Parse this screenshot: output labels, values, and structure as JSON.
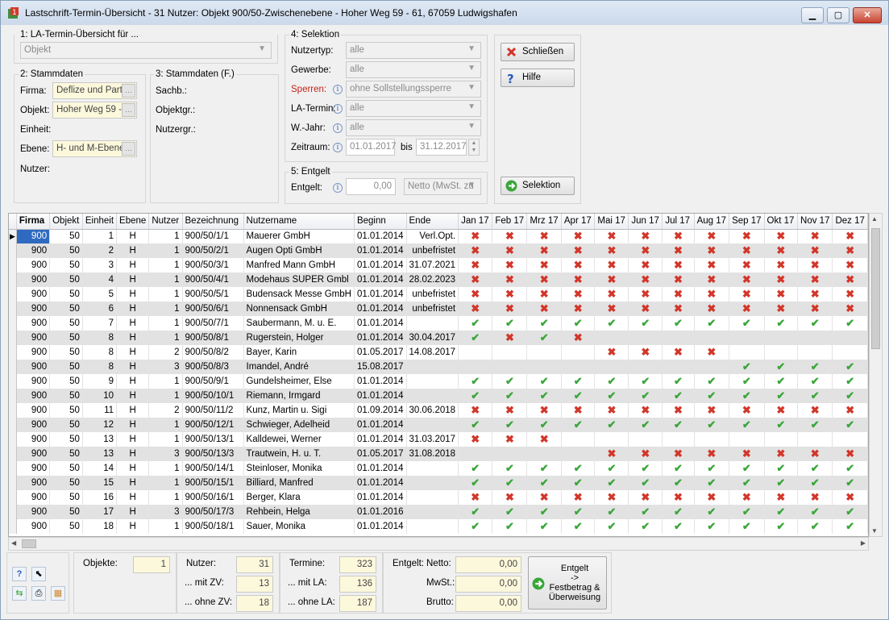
{
  "window": {
    "title": "Lastschrift-Termin-Übersicht - 31 Nutzer:  Objekt 900/50-Zwischenebene - Hoher Weg 59 - 61, 67059 Ludwigshafen"
  },
  "section1": {
    "label": "1: LA-Termin-Übersicht für ...",
    "value": "Objekt"
  },
  "section2": {
    "label": "2: Stammdaten",
    "firma_label": "Firma:",
    "firma_value": "Deflize und Partr",
    "objekt_label": "Objekt:",
    "objekt_value": "Hoher Weg 59 -",
    "einheit_label": "Einheit:",
    "ebene_label": "Ebene:",
    "ebene_value": "H- und M-Ebene",
    "nutzer_label": "Nutzer:"
  },
  "section3": {
    "label": "3: Stammdaten (F.)",
    "sachb": "Sachb.:",
    "objektgr": "Objektgr.:",
    "nutzergr": "Nutzergr.:"
  },
  "section4": {
    "label": "4: Selektion",
    "nutzertyp_label": "Nutzertyp:",
    "nutzertyp_value": "alle",
    "gewerbe_label": "Gewerbe:",
    "gewerbe_value": "alle",
    "sperren_label": "Sperren:",
    "sperren_value": "ohne Sollstellungssperre",
    "latermin_label": "LA-Termin:",
    "latermin_value": "alle",
    "wjahr_label": "W.-Jahr:",
    "wjahr_value": "alle",
    "zeitraum_label": "Zeitraum:",
    "from": "01.01.2017",
    "bis": "bis",
    "to": "31.12.2017"
  },
  "section5": {
    "label": "5: Entgelt",
    "entgelt_label": "Entgelt:",
    "entgelt_value": "0,00",
    "mode": "Netto (MwSt. zu"
  },
  "buttons": {
    "close": "Schließen",
    "help": "Hilfe",
    "select": "Selektion"
  },
  "table": {
    "columns": [
      "Firma",
      "Objekt",
      "Einheit",
      "Ebene",
      "Nutzer",
      "Bezeichnung",
      "Nutzername",
      "Beginn",
      "Ende",
      "Jan 17",
      "Feb 17",
      "Mrz 17",
      "Apr 17",
      "Mai 17",
      "Jun 17",
      "Jul 17",
      "Aug 17",
      "Sep 17",
      "Okt 17",
      "Nov 17",
      "Dez 17"
    ],
    "rows": [
      {
        "firma": "900",
        "objekt": "50",
        "einheit": "1",
        "ebene": "H",
        "nutzer": "1",
        "bez": "900/50/1/1",
        "name": "Mauerer GmbH",
        "beginn": "01.01.2014",
        "ende": "Verl.Opt.",
        "m": "xxxxxxxxxxxx"
      },
      {
        "firma": "900",
        "objekt": "50",
        "einheit": "2",
        "ebene": "H",
        "nutzer": "1",
        "bez": "900/50/2/1",
        "name": "Augen Opti GmbH",
        "beginn": "01.01.2014",
        "ende": "unbefristet",
        "m": "xxxxxxxxxxxx"
      },
      {
        "firma": "900",
        "objekt": "50",
        "einheit": "3",
        "ebene": "H",
        "nutzer": "1",
        "bez": "900/50/3/1",
        "name": "Manfred Mann GmbH",
        "beginn": "01.01.2014",
        "ende": "31.07.2021",
        "m": "xxxxxxxxxxxx"
      },
      {
        "firma": "900",
        "objekt": "50",
        "einheit": "4",
        "ebene": "H",
        "nutzer": "1",
        "bez": "900/50/4/1",
        "name": "Modehaus SUPER Gmbl",
        "beginn": "01.01.2014",
        "ende": "28.02.2023",
        "m": "xxxxxxxxxxxx"
      },
      {
        "firma": "900",
        "objekt": "50",
        "einheit": "5",
        "ebene": "H",
        "nutzer": "1",
        "bez": "900/50/5/1",
        "name": "Budensack Messe GmbH",
        "beginn": "01.01.2014",
        "ende": "unbefristet",
        "m": "xxxxxxxxxxxx"
      },
      {
        "firma": "900",
        "objekt": "50",
        "einheit": "6",
        "ebene": "H",
        "nutzer": "1",
        "bez": "900/50/6/1",
        "name": "Nonnensack GmbH",
        "beginn": "01.01.2014",
        "ende": "unbefristet",
        "m": "xxxxxxxxxxxx"
      },
      {
        "firma": "900",
        "objekt": "50",
        "einheit": "7",
        "ebene": "H",
        "nutzer": "1",
        "bez": "900/50/7/1",
        "name": "Saubermann, M. u. E.",
        "beginn": "01.01.2014",
        "ende": "",
        "m": "vvvvvvvvvvvv"
      },
      {
        "firma": "900",
        "objekt": "50",
        "einheit": "8",
        "ebene": "H",
        "nutzer": "1",
        "bez": "900/50/8/1",
        "name": "Rugerstein, Holger",
        "beginn": "01.01.2014",
        "ende": "30.04.2017",
        "m": "vxvx........"
      },
      {
        "firma": "900",
        "objekt": "50",
        "einheit": "8",
        "ebene": "H",
        "nutzer": "2",
        "bez": "900/50/8/2",
        "name": "Bayer, Karin",
        "beginn": "01.05.2017",
        "ende": "14.08.2017",
        "m": "....xxxx...."
      },
      {
        "firma": "900",
        "objekt": "50",
        "einheit": "8",
        "ebene": "H",
        "nutzer": "3",
        "bez": "900/50/8/3",
        "name": "Imandel, André",
        "beginn": "15.08.2017",
        "ende": "",
        "m": "........vvvv"
      },
      {
        "firma": "900",
        "objekt": "50",
        "einheit": "9",
        "ebene": "H",
        "nutzer": "1",
        "bez": "900/50/9/1",
        "name": "Gundelsheimer, Else",
        "beginn": "01.01.2014",
        "ende": "",
        "m": "vvvvvvvvvvvv"
      },
      {
        "firma": "900",
        "objekt": "50",
        "einheit": "10",
        "ebene": "H",
        "nutzer": "1",
        "bez": "900/50/10/1",
        "name": "Riemann, Irmgard",
        "beginn": "01.01.2014",
        "ende": "",
        "m": "vvvvvvvvvvvv"
      },
      {
        "firma": "900",
        "objekt": "50",
        "einheit": "11",
        "ebene": "H",
        "nutzer": "2",
        "bez": "900/50/11/2",
        "name": "Kunz, Martin u. Sigi",
        "beginn": "01.09.2014",
        "ende": "30.06.2018",
        "m": "xxxxxxxxxxxx"
      },
      {
        "firma": "900",
        "objekt": "50",
        "einheit": "12",
        "ebene": "H",
        "nutzer": "1",
        "bez": "900/50/12/1",
        "name": "Schwieger, Adelheid",
        "beginn": "01.01.2014",
        "ende": "",
        "m": "vvvvvvvvvvvv"
      },
      {
        "firma": "900",
        "objekt": "50",
        "einheit": "13",
        "ebene": "H",
        "nutzer": "1",
        "bez": "900/50/13/1",
        "name": "Kalldewei, Werner",
        "beginn": "01.01.2014",
        "ende": "31.03.2017",
        "m": "xxx........."
      },
      {
        "firma": "900",
        "objekt": "50",
        "einheit": "13",
        "ebene": "H",
        "nutzer": "3",
        "bez": "900/50/13/3",
        "name": "Trautwein, H. u. T.",
        "beginn": "01.05.2017",
        "ende": "31.08.2018",
        "m": "....xxxxxxxx"
      },
      {
        "firma": "900",
        "objekt": "50",
        "einheit": "14",
        "ebene": "H",
        "nutzer": "1",
        "bez": "900/50/14/1",
        "name": "Steinloser, Monika",
        "beginn": "01.01.2014",
        "ende": "",
        "m": "vvvvvvvvvvvv"
      },
      {
        "firma": "900",
        "objekt": "50",
        "einheit": "15",
        "ebene": "H",
        "nutzer": "1",
        "bez": "900/50/15/1",
        "name": "Billiard, Manfred",
        "beginn": "01.01.2014",
        "ende": "",
        "m": "vvvvvvvvvvvv"
      },
      {
        "firma": "900",
        "objekt": "50",
        "einheit": "16",
        "ebene": "H",
        "nutzer": "1",
        "bez": "900/50/16/1",
        "name": "Berger, Klara",
        "beginn": "01.01.2014",
        "ende": "",
        "m": "xxxxxxxxxxxx"
      },
      {
        "firma": "900",
        "objekt": "50",
        "einheit": "17",
        "ebene": "H",
        "nutzer": "3",
        "bez": "900/50/17/3",
        "name": "Rehbein, Helga",
        "beginn": "01.01.2016",
        "ende": "",
        "m": "vvvvvvvvvvvv"
      },
      {
        "firma": "900",
        "objekt": "50",
        "einheit": "18",
        "ebene": "H",
        "nutzer": "1",
        "bez": "900/50/18/1",
        "name": "Sauer, Monika",
        "beginn": "01.01.2014",
        "ende": "",
        "m": "vvvvvvvvvvvv"
      }
    ]
  },
  "footer": {
    "objekte_label": "Objekte:",
    "objekte": "1",
    "nutzer_label": "Nutzer:",
    "nutzer": "31",
    "mitzv_label": "... mit ZV:",
    "mitzv": "13",
    "ohnezv_label": "... ohne ZV:",
    "ohnezv": "18",
    "termine_label": "Termine:",
    "termine": "323",
    "mitla_label": "... mit LA:",
    "mitla": "136",
    "ohnela_label": "... ohne LA:",
    "ohnela": "187",
    "entgelt_label": "Entgelt:",
    "netto_label": "Netto:",
    "netto": "0,00",
    "mwst_label": "MwSt.:",
    "mwst": "0,00",
    "brutto_label": "Brutto:",
    "brutto": "0,00",
    "festbetrag_btn_line1": "Entgelt",
    "festbetrag_btn_line2": "->",
    "festbetrag_btn_line3": "Festbetrag &",
    "festbetrag_btn_line4": "Überweisung"
  }
}
